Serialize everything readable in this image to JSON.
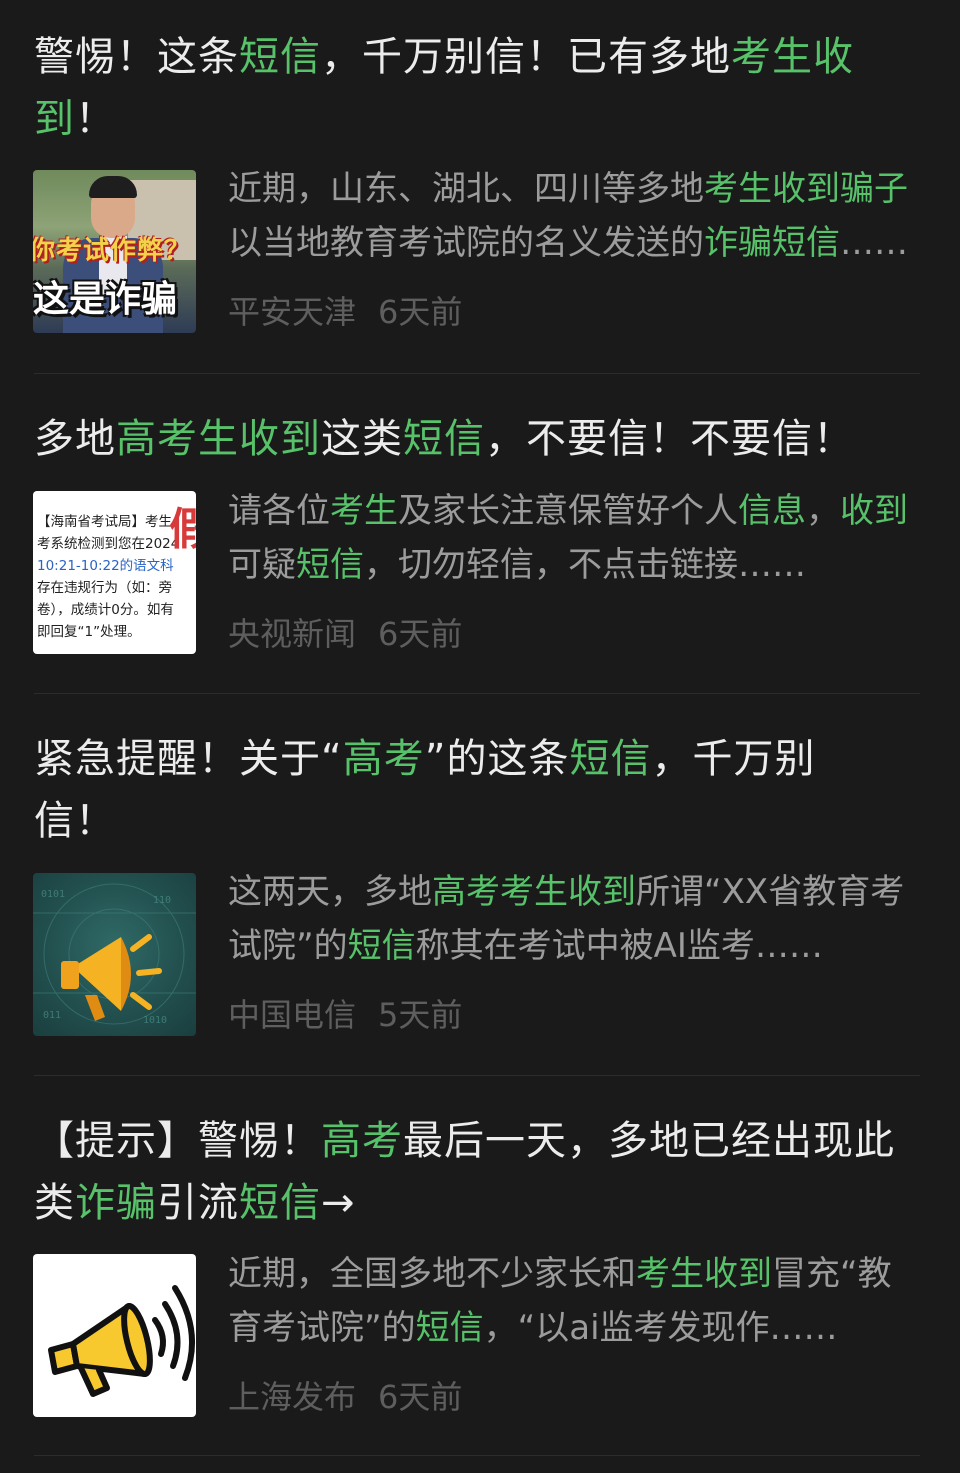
{
  "colors": {
    "background": "#1a1a1a",
    "highlight": "#57c26a",
    "title": "#ececec",
    "snippet": "#9c9c9c",
    "meta": "#5e5e5e"
  },
  "items": [
    {
      "title_parts": [
        {
          "t": "警惕！这条",
          "hl": false
        },
        {
          "t": "短信",
          "hl": true
        },
        {
          "t": "，千万别信！已有多地",
          "hl": false
        },
        {
          "t": "考生收到",
          "hl": true
        },
        {
          "t": "！",
          "hl": false
        }
      ],
      "snippet_parts": [
        {
          "t": "近期，山东、湖北、四川等多地",
          "hl": false
        },
        {
          "t": "考生收到骗子",
          "hl": true
        },
        {
          "t": "以当地教育考试院的名义发送的",
          "hl": false
        },
        {
          "t": "诈骗短信",
          "hl": true
        },
        {
          "t": "……",
          "hl": false
        }
      ],
      "source": "平安天津",
      "time": "6天前",
      "thumb": {
        "icon": "police-video-thumbnail",
        "caption_top": "你考试作弊？",
        "caption_bottom": "这是诈骗"
      }
    },
    {
      "title_parts": [
        {
          "t": "多地",
          "hl": false
        },
        {
          "t": "高考生收到",
          "hl": true
        },
        {
          "t": "这类",
          "hl": false
        },
        {
          "t": "短信",
          "hl": true
        },
        {
          "t": "，不要信！不要信！",
          "hl": false
        }
      ],
      "snippet_parts": [
        {
          "t": "请各位",
          "hl": false
        },
        {
          "t": "考生",
          "hl": true
        },
        {
          "t": "及家长注意保管好个人",
          "hl": false
        },
        {
          "t": "信息",
          "hl": true
        },
        {
          "t": "，",
          "hl": false
        },
        {
          "t": "收到",
          "hl": true
        },
        {
          "t": "可疑",
          "hl": false
        },
        {
          "t": "短信",
          "hl": true
        },
        {
          "t": "，切勿轻信，不点击链接……",
          "hl": false
        }
      ],
      "source": "央视新闻",
      "time": "6天前",
      "thumb": {
        "icon": "sms-screenshot-thumbnail",
        "lines": [
          "【海南省考试局】考生",
          "考系统检测到您在2024",
          "10:21-10:22的语文科",
          "存在违规行为（如：旁",
          "卷），成绩计0分。如有",
          "即回复“1”处理。"
        ],
        "stamp": "假"
      }
    },
    {
      "title_parts": [
        {
          "t": "紧急提醒！关于“",
          "hl": false
        },
        {
          "t": "高考",
          "hl": true
        },
        {
          "t": "”的这条",
          "hl": false
        },
        {
          "t": "短信",
          "hl": true
        },
        {
          "t": "，千万别信！",
          "hl": false
        }
      ],
      "snippet_parts": [
        {
          "t": "这两天，多地",
          "hl": false
        },
        {
          "t": "高考考生收到",
          "hl": true
        },
        {
          "t": "所谓“XX省教育考试院”的",
          "hl": false
        },
        {
          "t": "短信",
          "hl": true
        },
        {
          "t": "称其在考试中被AI监考……",
          "hl": false
        }
      ],
      "source": "中国电信",
      "time": "5天前",
      "thumb": {
        "icon": "megaphone-icon"
      }
    },
    {
      "title_parts": [
        {
          "t": "【提示】警惕！",
          "hl": false
        },
        {
          "t": "高考",
          "hl": true
        },
        {
          "t": "最后一天，多地已经出现此类",
          "hl": false
        },
        {
          "t": "诈骗",
          "hl": true
        },
        {
          "t": "引流",
          "hl": false
        },
        {
          "t": "短信",
          "hl": true
        },
        {
          "t": "→",
          "hl": false
        }
      ],
      "snippet_parts": [
        {
          "t": "近期，全国多地不少家长和",
          "hl": false
        },
        {
          "t": "考生收到",
          "hl": true
        },
        {
          "t": "冒充“教育考试院”的",
          "hl": false
        },
        {
          "t": "短信",
          "hl": true
        },
        {
          "t": "，“以ai监考发现作……",
          "hl": false
        }
      ],
      "source": "上海发布",
      "time": "6天前",
      "thumb": {
        "icon": "megaphone-sound-icon"
      }
    }
  ]
}
